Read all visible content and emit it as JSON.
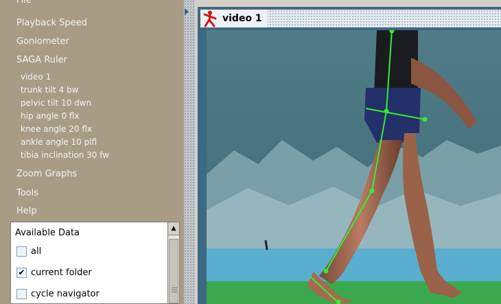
{
  "sidebar": {
    "menu": {
      "file": "File",
      "playback_speed": "Playback Speed",
      "goniometer": "Goniometer",
      "saga_ruler": "SAGA Ruler",
      "zoom_graphs": "Zoom Graphs",
      "tools": "Tools",
      "help": "Help"
    },
    "saga_lines": [
      "video 1",
      "trunk tilt  4 bw",
      "pelvic tilt  10 dwn",
      "hip angle  0 flx",
      "knee angle  20 flx",
      "ankle angle  10 plfl",
      "tibia inclination  30 fw"
    ]
  },
  "available_data": {
    "title": "Available Data",
    "options": [
      {
        "label": "all",
        "checked": false
      },
      {
        "label": "current folder",
        "checked": true
      },
      {
        "label": "cycle navigator",
        "checked": false
      }
    ]
  },
  "video": {
    "title": "video 1",
    "icon": "running-figure-icon"
  },
  "colors": {
    "sidebar_bg": "#a89c84",
    "overlay_line": "#33ee33",
    "title_icon": "#cc1a12"
  }
}
